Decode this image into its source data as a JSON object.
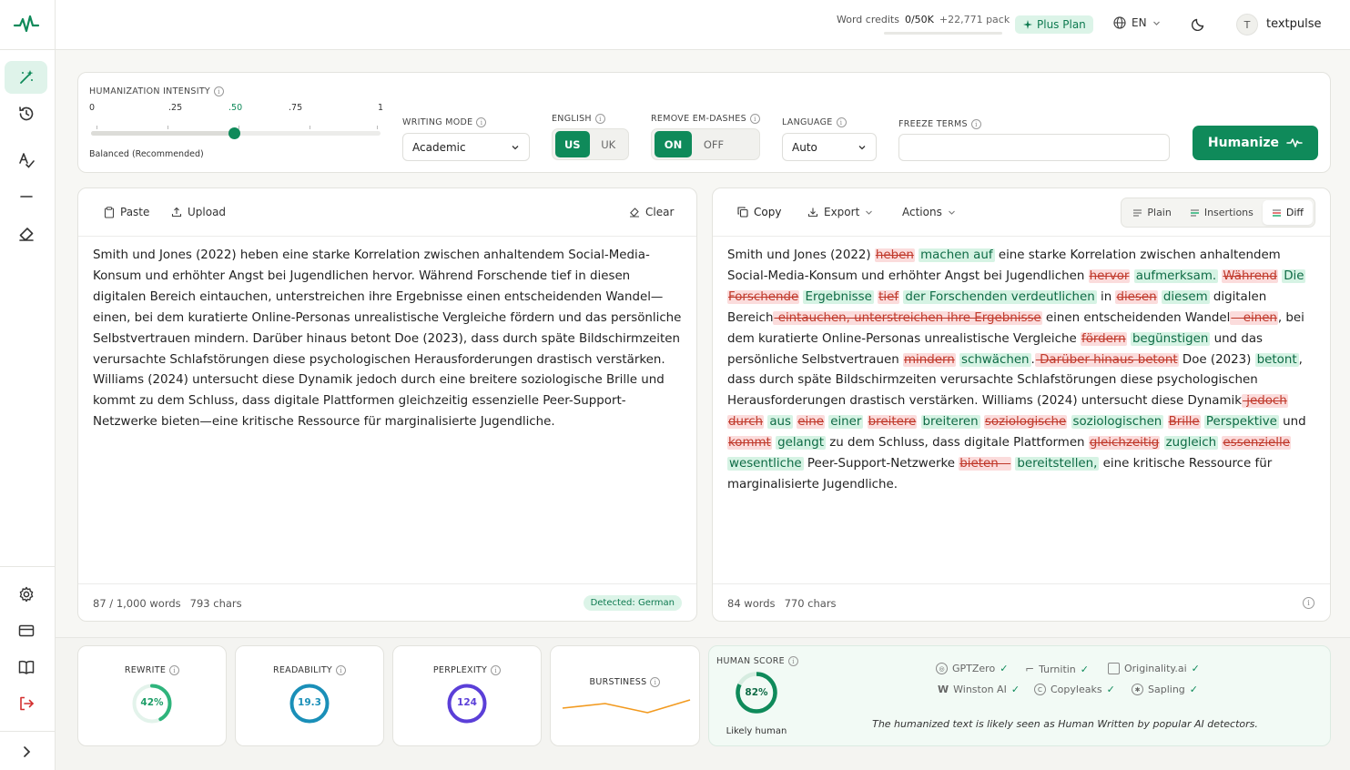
{
  "app": {
    "name": "textpulse"
  },
  "header": {
    "credits_label": "Word credits",
    "credits_value": "0/50K",
    "credits_pack": "+22,771 pack",
    "credits_used_fraction": 0.0,
    "plan": "Plus Plan",
    "language": "EN",
    "avatar_initial": "T",
    "username": "textpulse"
  },
  "controls": {
    "intensity_label": "HUMANIZATION INTENSITY",
    "intensity_ticks": [
      "0",
      ".25",
      ".50",
      ".75",
      "1"
    ],
    "intensity_value": 0.5,
    "intensity_caption": "Balanced (Recommended)",
    "writing_mode_label": "WRITING MODE",
    "writing_mode_value": "Academic",
    "english_label": "ENGLISH",
    "english_options": [
      "US",
      "UK"
    ],
    "english_selected": "US",
    "emdash_label": "REMOVE EM-DASHES",
    "emdash_options": [
      "ON",
      "OFF"
    ],
    "emdash_selected": "ON",
    "language_label": "LANGUAGE",
    "language_value": "Auto",
    "freeze_label": "FREEZE TERMS",
    "freeze_value": "",
    "humanize_button": "Humanize"
  },
  "input_pane": {
    "paste": "Paste",
    "upload": "Upload",
    "clear": "Clear",
    "text": "Smith und Jones (2022) heben eine starke Korrelation zwischen anhaltendem Social-Media-Konsum und erhöhter Angst bei Jugendlichen hervor. Während Forschende tief in diesen digitalen Bereich eintauchen, unterstreichen ihre Ergebnisse einen entscheidenden Wandel—einen, bei dem kuratierte Online-Personas unrealistische Vergleiche fördern und das persönliche Selbstvertrauen mindern. Darüber hinaus betont Doe (2023), dass durch späte Bildschirmzeiten verursachte Schlafstörungen diese psychologischen Herausforderungen drastisch verstärken. Williams (2024) untersucht diese Dynamik jedoch durch eine breitere soziologische Brille und kommt zu dem Schluss, dass digitale Plattformen gleichzeitig essenzielle Peer-Support-Netzwerke bieten—eine kritische Ressource für marginalisierte Jugendliche.",
    "words": "87 / 1,000 words",
    "chars": "793 chars",
    "detected": "Detected: German"
  },
  "output_pane": {
    "copy": "Copy",
    "export": "Export",
    "actions": "Actions",
    "view_tabs": [
      "Plain",
      "Insertions",
      "Diff"
    ],
    "view_selected": "Diff",
    "segments": [
      {
        "t": "Smith und Jones (2022) "
      },
      {
        "d": "heben"
      },
      {
        "t": " "
      },
      {
        "i": "machen auf"
      },
      {
        "t": " eine starke Korrelation zwischen anhaltendem Social-Media-Konsum und erhöhter Angst bei Jugendlichen "
      },
      {
        "d": "hervor"
      },
      {
        "t": " "
      },
      {
        "i": "aufmerksam."
      },
      {
        "t": " "
      },
      {
        "d": "Während"
      },
      {
        "t": " "
      },
      {
        "i": "Die"
      },
      {
        "t": " "
      },
      {
        "d": "Forschende"
      },
      {
        "t": " "
      },
      {
        "i": "Ergebnisse"
      },
      {
        "t": " "
      },
      {
        "d": "tief"
      },
      {
        "t": " "
      },
      {
        "i": "der Forschenden verdeutlichen"
      },
      {
        "t": " in "
      },
      {
        "d": "diesen"
      },
      {
        "t": " "
      },
      {
        "i": "diesem"
      },
      {
        "t": " digitalen Bereich"
      },
      {
        "d": " eintauchen, unterstreichen ihre Ergebnisse"
      },
      {
        "t": " einen entscheidenden Wandel"
      },
      {
        "d": "—einen"
      },
      {
        "t": ", bei dem kuratierte Online-Personas unrealistische Vergleiche "
      },
      {
        "d": "fördern"
      },
      {
        "t": " "
      },
      {
        "i": "begünstigen"
      },
      {
        "t": " und das persönliche Selbstvertrauen "
      },
      {
        "d": "mindern"
      },
      {
        "t": " "
      },
      {
        "i": "schwächen"
      },
      {
        "t": "."
      },
      {
        "d": " Darüber hinaus betont"
      },
      {
        "t": " Doe (2023) "
      },
      {
        "i": "betont"
      },
      {
        "t": ", dass durch späte Bildschirmzeiten verursachte Schlafstörungen diese psychologischen Herausforderungen drastisch verstärken. Williams (2024) untersucht diese Dynamik"
      },
      {
        "d": " jedoch"
      },
      {
        "t": " "
      },
      {
        "d": "durch"
      },
      {
        "t": " "
      },
      {
        "i": "aus"
      },
      {
        "t": " "
      },
      {
        "d": "eine"
      },
      {
        "t": " "
      },
      {
        "i": "einer"
      },
      {
        "t": " "
      },
      {
        "d": "breitere"
      },
      {
        "t": " "
      },
      {
        "i": "breiteren"
      },
      {
        "t": " "
      },
      {
        "d": "soziologische"
      },
      {
        "t": " "
      },
      {
        "i": "soziologischen"
      },
      {
        "t": " "
      },
      {
        "d": "Brille"
      },
      {
        "t": " "
      },
      {
        "i": "Perspektive"
      },
      {
        "t": " und "
      },
      {
        "d": "kommt"
      },
      {
        "t": " "
      },
      {
        "i": "gelangt"
      },
      {
        "t": " zu dem Schluss, dass digitale Plattformen "
      },
      {
        "d": "gleichzeitig"
      },
      {
        "t": " "
      },
      {
        "i": "zugleich"
      },
      {
        "t": " "
      },
      {
        "d": "essenzielle"
      },
      {
        "t": " "
      },
      {
        "i": "wesentliche"
      },
      {
        "t": " Peer-Support-Netzwerke "
      },
      {
        "d": "bieten—"
      },
      {
        "t": " "
      },
      {
        "i": "bereitstellen,"
      },
      {
        "t": " eine kritische Ressource für marginalisierte Jugendliche."
      }
    ],
    "words": "84 words",
    "chars": "770 chars"
  },
  "stats": {
    "rewrite_label": "REWRITE",
    "rewrite_value": "42%",
    "rewrite_fraction": 0.42,
    "readability_label": "READABILITY",
    "readability_value": "19.3",
    "perplexity_label": "PERPLEXITY",
    "perplexity_value": "124",
    "burstiness_label": "BURSTINESS",
    "burstiness_series": [
      0.35,
      0.6,
      0.1,
      0.8
    ]
  },
  "human_score": {
    "label": "HUMAN SCORE",
    "value": "82%",
    "fraction": 0.82,
    "verdict": "Likely human",
    "detectors": [
      "GPTZero",
      "Turnitin",
      "Originality.ai",
      "Winston AI",
      "Copyleaks",
      "Sapling"
    ],
    "note": "The humanized text is likely seen as Human Written by popular AI detectors."
  },
  "colors": {
    "accent": "#0f8a5a",
    "rewrite": "#2fb47c",
    "readability": "#1a8fb8",
    "perplexity": "#5b3fd8",
    "burstiness": "#f29a1f"
  }
}
